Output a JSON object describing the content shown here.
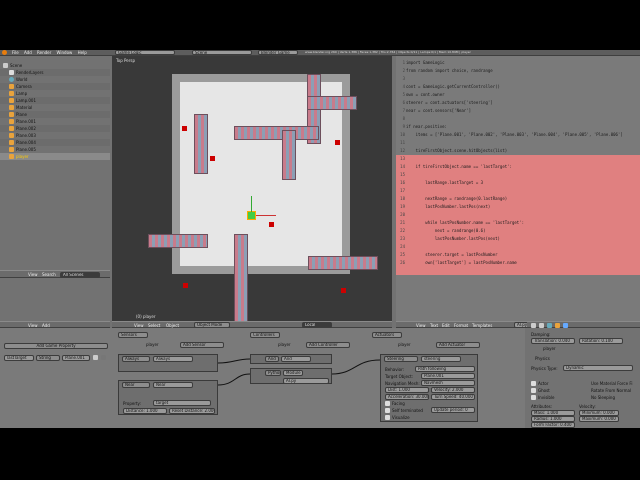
{
  "info_bar": {
    "menus": [
      "File",
      "Add",
      "Render",
      "Window",
      "Help"
    ],
    "screen": "Game Logic",
    "scene": "Scene",
    "engine": "Blender Game",
    "stats": "www.blender.org 260 | Verts:1,386 | Faces:1,382 | Tris:2,764 | Objects:0/11 | Lamps:0/1 | Mem:10.89M | player"
  },
  "outliner": {
    "search_label": "All Scenes",
    "rows": [
      "Scene",
      "RenderLayers",
      "World",
      "Camera",
      "Lamp",
      "Lamp.001",
      "Material",
      "Plane",
      "Plane.001",
      "Plane.002",
      "Plane.003",
      "Plane.004",
      "Plane.005",
      "player"
    ],
    "header_menus": [
      "View",
      "Search"
    ]
  },
  "viewport": {
    "label": "Top Persp",
    "object_label": "(0) player",
    "header_menus": [
      "View",
      "Select",
      "Object"
    ],
    "mode": "Object Mode",
    "pivot": "Local"
  },
  "text_editor": {
    "filename": "AI.py",
    "run_button": "Run Script",
    "header_menus": [
      "View",
      "Text",
      "Edit",
      "Format",
      "Templates"
    ],
    "lines": [
      "import GameLogic",
      "from random import choice, randrange",
      "",
      "cont = GameLogic.getCurrentController()",
      "own = cont.owner",
      "steerer = cont.actuators['steering']",
      "near = cont.sensors['Near']",
      "",
      "if near.positive:",
      "    items = ['Plane.001', 'Plane.002', 'Plane.003', 'Plane.004', 'Plane.005', 'Plane.006']",
      "",
      "    tireFirstObject.scene.hitObjects(list)",
      "",
      "    if tireFirstObject.name == 'lastTarget':",
      "",
      "        lastRange.lastTarget = 3",
      "",
      "        nextRange = randrange(0.lastRange)",
      "        lastPosNumber.lastPos(next)",
      "",
      "        while lastPosNumber.name == 'lastTarget':",
      "            next = randrange(0.6)",
      "            lastPosNumber.lastPos(next)",
      "",
      "        steerer.target = lastPosNumber",
      "        own['lastTarget'] = lastPosNumber.name"
    ]
  },
  "logic": {
    "header_menus": [
      "View",
      "Add"
    ],
    "add_property": "Add Game Property",
    "property": {
      "name": "lastTarget",
      "type": "String",
      "value": "Plane.001"
    },
    "sensors_label": "Sensors",
    "controllers_label": "Controllers",
    "actuators_label": "Actuators",
    "object_name": "player",
    "add_sensor": "Add Sensor",
    "add_controller": "Add Controller",
    "add_actuator": "Add Actuator",
    "sel": "Sel",
    "act": "Act",
    "link": "Link",
    "state": "State",
    "sensor1": {
      "type": "Always",
      "name": "Always"
    },
    "sensor2": {
      "type": "Near",
      "name": "Near",
      "property_label": "Property:",
      "property": "target",
      "distance": "Distance: 1.000",
      "reset": "Reset Distance: 2.000"
    },
    "controller1": {
      "type": "And",
      "name": "And"
    },
    "controller2": {
      "type": "Python",
      "mode": "Module",
      "script": "AI.py"
    },
    "actuator": {
      "type": "Steering",
      "name": "steering",
      "behavior_label": "Behavior:",
      "behavior": "Path following",
      "target_label": "Target Object:",
      "target": "Plane.001",
      "navmesh_label": "Navigation Mesh:",
      "navmesh": "Navmesh",
      "dist": "Dist: 1.000",
      "velocity": "Velocity: 2.000",
      "accel": "Acceleration: 30.000",
      "turn": "Turn Speed: 40.000",
      "facing": "Facing",
      "axis": "Self terminated",
      "update": "Update period: 0",
      "visualize": "Visualize"
    }
  },
  "properties": {
    "object": "player",
    "physics_label": "Physics",
    "physics_type_label": "Physics Type:",
    "physics_type": "Dynamic",
    "actor": "Actor",
    "ghost": "Ghost",
    "invisible": "Invisible",
    "use_material_force": "Use Material Force Fi",
    "rotate_from_normal": "Rotate From Normal",
    "no_sleeping": "No Sleeping",
    "attributes_label": "Attributes:",
    "mass": "Mass: 1.000",
    "radius": "Radius: 1.000",
    "form_factor": "Form Factor: 0.400",
    "velocity_label": "Velocity:",
    "min": "Minimum: 0.000",
    "max": "Maximum: 0.000",
    "damping_label": "Damping:",
    "translation": "Translation: 0.040",
    "rotation": "Rotation: 0.100"
  }
}
